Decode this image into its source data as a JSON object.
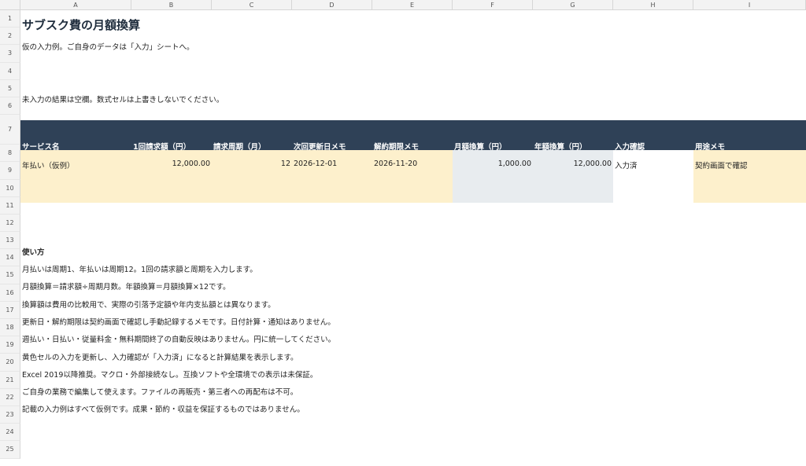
{
  "columns": [
    "A",
    "B",
    "C",
    "D",
    "E",
    "F",
    "G",
    "H",
    "I"
  ],
  "rows": [
    "1",
    "2",
    "3",
    "4",
    "5",
    "6",
    "7",
    "8",
    "9",
    "10",
    "11",
    "12",
    "13",
    "14",
    "15",
    "16",
    "17",
    "18",
    "19",
    "20",
    "21",
    "22",
    "23",
    "24",
    "25"
  ],
  "sheet": {
    "title": "サブスク費の月額換算",
    "subtitle": "仮の入力例。ご自身のデータは「入力」シートへ。",
    "note": "未入力の結果は空欄。数式セルは上書きしないでください。"
  },
  "table": {
    "headers": [
      "サービス名",
      "1回請求額（円）",
      "請求周期（月）",
      "次回更新日メモ",
      "解約期限メモ",
      "月額換算（円）",
      "年額換算（円）",
      "入力確認",
      "用途メモ"
    ],
    "row": {
      "service": "年払い（仮例）",
      "amount": "12,000.00",
      "cycle": "12",
      "next_renewal": "2026-12-01",
      "cancel_deadline": "2026-11-20",
      "monthly": "1,000.00",
      "yearly": "12,000.00",
      "status": "入力済",
      "memo": "契約画面で確認"
    }
  },
  "howto": {
    "heading": "使い方",
    "lines": [
      "月払いは周期1、年払いは周期12。1回の請求額と周期を入力します。",
      "月額換算＝請求額÷周期月数。年額換算＝月額換算×12です。",
      "換算額は費用の比較用で、実際の引落予定額や年内支払額とは異なります。",
      "更新日・解約期限は契約画面で確認し手動記録するメモです。日付計算・通知はありません。",
      "週払い・日払い・従量料金・無料期間終了の自動反映はありません。円に統一してください。",
      "黄色セルの入力を更新し、入力確認が「入力済」になると計算結果を表示します。",
      "Excel 2019以降推奨。マクロ・外部接続なし。互換ソフトや全環境での表示は未保証。",
      "ご自身の業務で編集して使えます。ファイルの再販売・第三者への再配布は不可。",
      "記載の入力例はすべて仮例です。成果・節約・収益を保証するものではありません。"
    ]
  }
}
